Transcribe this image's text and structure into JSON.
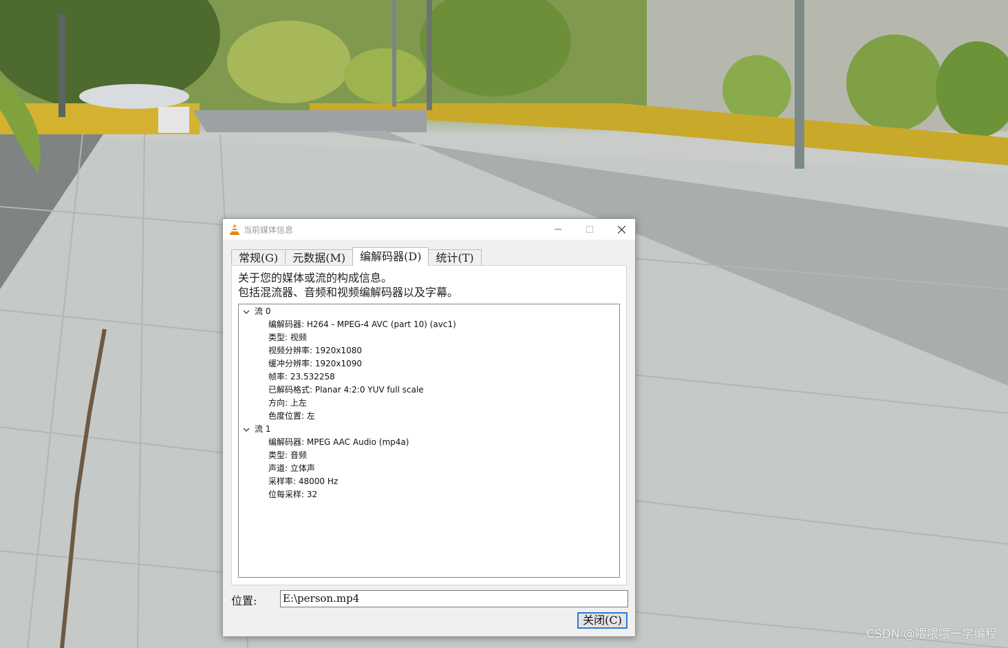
{
  "window": {
    "title": "当前媒体信息"
  },
  "tabs": [
    {
      "label": "常规(G)",
      "active": false
    },
    {
      "label": "元数据(M)",
      "active": false
    },
    {
      "label": "编解码器(D)",
      "active": true
    },
    {
      "label": "统计(T)",
      "active": false
    }
  ],
  "description": {
    "line1": "关于您的媒体或流的构成信息。",
    "line2": "包括混流器、音频和视频编解码器以及字幕。"
  },
  "streams": [
    {
      "label": "流 0",
      "expanded": true,
      "items": [
        "编解码器: H264 - MPEG-4 AVC (part 10) (avc1)",
        "类型: 视频",
        "视频分辨率: 1920x1080",
        "缓冲分辨率: 1920x1090",
        "帧率: 23.532258",
        "已解码格式: Planar 4:2:0 YUV full scale",
        "方向: 上左",
        "色度位置: 左"
      ]
    },
    {
      "label": "流 1",
      "expanded": true,
      "items": [
        "编解码器: MPEG AAC Audio (mp4a)",
        "类型: 音频",
        "声道: 立体声",
        "采样率: 48000 Hz",
        "位每采样: 32"
      ]
    }
  ],
  "location": {
    "label": "位置:",
    "value": "E:\\person.mp4"
  },
  "buttons": {
    "close": "关闭(C)"
  },
  "watermark": "CSDN @喂喂喂一学编程",
  "icons": {
    "app": "vlc-cone-icon",
    "minimize": "minimize-icon",
    "maximize": "maximize-icon",
    "close": "close-icon",
    "expand": "chevron-down-icon"
  },
  "colors": {
    "focus_border": "#2b7bd1",
    "vlc_orange": "#f08a00"
  }
}
